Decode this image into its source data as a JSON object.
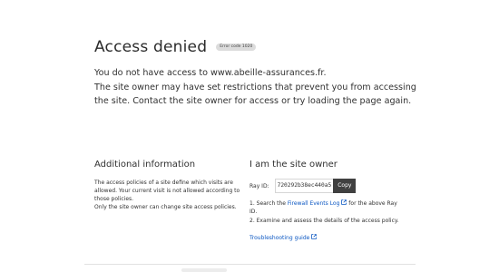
{
  "header": {
    "title": "Access denied",
    "error_badge": "Error code 1020"
  },
  "lead": {
    "line1": "You do not have access to www.abeille-assurances.fr.",
    "line2": "The site owner may have set restrictions that prevent you from accessing the site. Contact the site owner for access or try loading the page again."
  },
  "additional_info": {
    "title": "Additional information",
    "para1": "The access policies of a site define which visits are allowed. Your current visit is not allowed according to those policies.",
    "para2": "Only the site owner can change site access policies."
  },
  "site_owner": {
    "title": "I am the site owner",
    "ray_label": "Ray ID:",
    "ray_id": "720292b38ec440a5",
    "copy_label": "Copy",
    "step1_prefix": "1. Search the ",
    "step1_link": "Firewall Events Log",
    "step1_suffix": " for the above Ray ID.",
    "step2": "2. Examine and assess the details of the access policy.",
    "troubleshooting_link": "Troubleshooting guide"
  },
  "colors": {
    "link": "#0a56c2",
    "copy_button_bg": "#404040",
    "badge_bg": "#dcdcdc"
  },
  "icons": {
    "external_link": "external-link-icon"
  }
}
